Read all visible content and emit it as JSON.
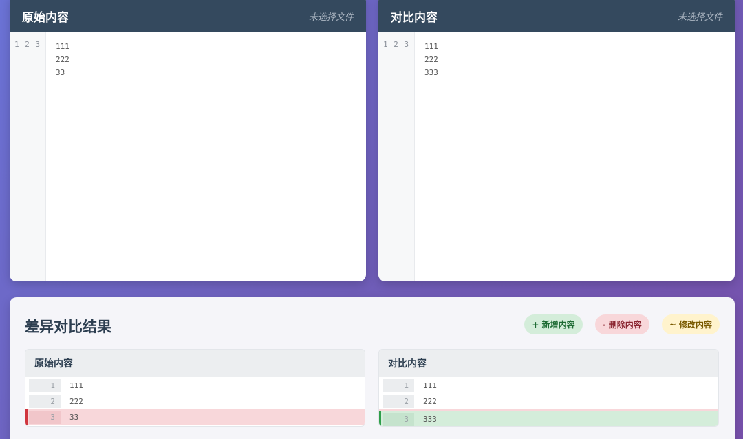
{
  "editors": {
    "left": {
      "title": "原始内容",
      "file_status": "未选择文件",
      "line_numbers": "1 2 3",
      "lines": [
        "111",
        "222",
        "33"
      ]
    },
    "right": {
      "title": "对比内容",
      "file_status": "未选择文件",
      "line_numbers": "1 2 3",
      "lines": [
        "111",
        "222",
        "333"
      ]
    }
  },
  "result": {
    "title": "差异对比结果",
    "legend": {
      "added": "+ 新增内容",
      "removed": "- 删除内容",
      "modified": "~ 修改内容"
    },
    "left": {
      "title": "原始内容",
      "rows": [
        {
          "num": "1",
          "text": "111",
          "type": "same"
        },
        {
          "num": "2",
          "text": "222",
          "type": "same"
        },
        {
          "num": "3",
          "text": "33",
          "type": "removed"
        }
      ]
    },
    "right": {
      "title": "对比内容",
      "rows": [
        {
          "num": "1",
          "text": "111",
          "type": "same"
        },
        {
          "num": "2",
          "text": "222",
          "type": "same"
        },
        {
          "num": "3",
          "text": "333",
          "type": "added"
        }
      ]
    }
  },
  "colors": {
    "header_bg": "#34495e",
    "added_bg": "#d4edda",
    "removed_bg": "#f8d7da",
    "modified_bg": "#fff3cd",
    "added_accent": "#2e9e4a",
    "removed_accent": "#d0353f"
  }
}
